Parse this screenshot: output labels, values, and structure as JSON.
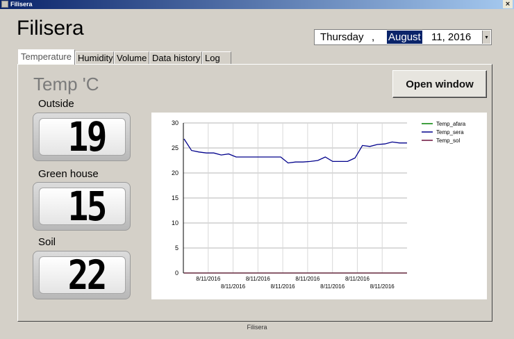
{
  "window": {
    "title": "Filisera",
    "close_glyph": "×"
  },
  "app_title": "Filisera",
  "date_picker": {
    "day_name": "Thursday",
    "separator": ",",
    "month": "August",
    "day_year": "11, 2016",
    "dropdown_glyph": "▾"
  },
  "tabs": [
    {
      "label": "Temperature",
      "active": true
    },
    {
      "label": "Humidity"
    },
    {
      "label": "Volume"
    },
    {
      "label": "Data history"
    },
    {
      "label": "Log"
    }
  ],
  "temperature": {
    "heading": "Temp 'C",
    "open_window_label": "Open window",
    "gauges": [
      {
        "label": "Outside",
        "value": "19"
      },
      {
        "label": "Green house",
        "value": "15"
      },
      {
        "label": "Soil",
        "value": "22"
      }
    ]
  },
  "chart_data": {
    "type": "line",
    "y_ticks": [
      "30",
      "25",
      "20",
      "15",
      "10",
      "5",
      "0"
    ],
    "ylim": [
      0,
      30
    ],
    "x_tick_labels": [
      "8/11/2016",
      "8/11/2016",
      "8/11/2016",
      "8/11/2016",
      "8/11/2016",
      "8/11/2016",
      "8/11/2016",
      "8/11/2016"
    ],
    "grid": true,
    "legend_position": "top-right",
    "series": [
      {
        "name": "Temp_afara",
        "color": "#008000",
        "values": [
          0,
          0,
          0,
          0,
          0,
          0,
          0,
          0,
          0,
          0
        ]
      },
      {
        "name": "Temp_sera",
        "color": "#00008b",
        "values": [
          26.8,
          24.5,
          24.2,
          24.0,
          24.0,
          23.6,
          23.8,
          23.2,
          23.2,
          23.2,
          23.2,
          23.2,
          23.2,
          23.2,
          22.0,
          22.2,
          22.2,
          22.3,
          22.5,
          23.2,
          22.3,
          22.3,
          22.3,
          23.0,
          25.5,
          25.3,
          25.7,
          25.8,
          26.2,
          26.0,
          26.0
        ]
      },
      {
        "name": "Temp_sol",
        "color": "#6b0f3a",
        "values": [
          0,
          0,
          0,
          0,
          0,
          0,
          0,
          0,
          0,
          0
        ]
      }
    ]
  },
  "status_bar": "Filisera"
}
